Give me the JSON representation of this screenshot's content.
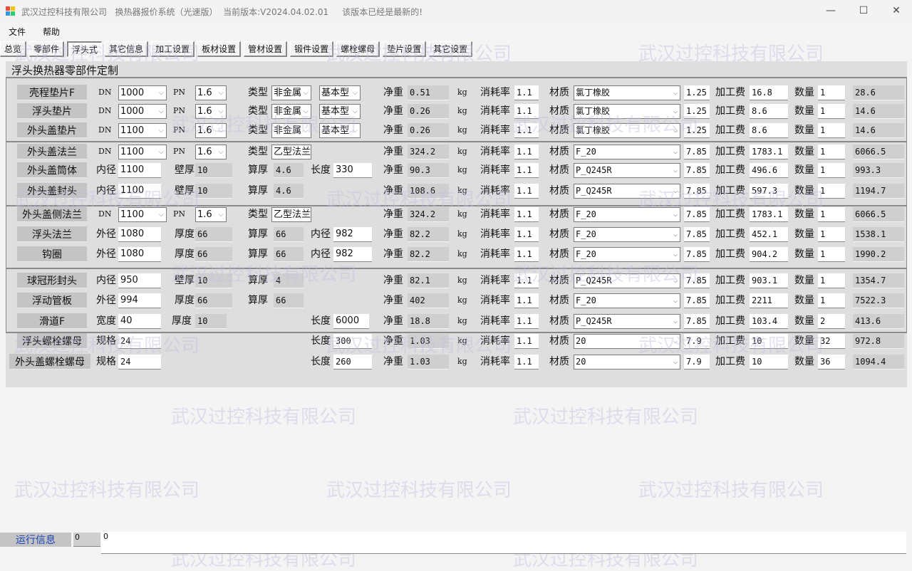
{
  "window": {
    "title": "武汉过控科技有限公司   换热器报价系统（光速版）  当前版本:V2024.04.02.01     该版本已经是最新的!",
    "minimize": "—",
    "maximize": "☐",
    "close": "✕"
  },
  "menu": [
    "文件",
    "帮助"
  ],
  "tabs": [
    {
      "label": "总览",
      "active": false
    },
    {
      "label": "零部件",
      "active": false
    },
    {
      "label": "浮头式",
      "active": true
    },
    {
      "label": "其它信息",
      "active": false
    },
    {
      "label": "加工设置",
      "active": false
    },
    {
      "label": "板材设置",
      "active": false
    },
    {
      "label": "管材设置",
      "active": false
    },
    {
      "label": "锻件设置",
      "active": false
    },
    {
      "label": "螺栓螺母",
      "active": false
    },
    {
      "label": "垫片设置",
      "active": false
    },
    {
      "label": "其它设置",
      "active": false
    }
  ],
  "panel": {
    "title": "浮头换热器零部件定制",
    "labels": {
      "net_weight": "净重",
      "unit": "kg",
      "loss_rate": "消耗率",
      "material": "材质",
      "processing_fee": "加工费",
      "quantity": "数量"
    },
    "rows": [
      {
        "name": "壳程垫片F",
        "fields": [
          {
            "label": "DN",
            "value": "1000",
            "kind": "select"
          },
          {
            "label": "PN",
            "value": "1.6",
            "kind": "select"
          },
          {
            "label": "类型",
            "value": "非金属",
            "kind": "select"
          },
          {
            "label": "",
            "value": "基本型",
            "kind": "select"
          }
        ],
        "net_weight": "0.51",
        "loss_rate": "1.1",
        "material": "氯丁橡胶",
        "density": "1.25",
        "processing_fee": "16.8",
        "quantity": "1",
        "total": "28.6"
      },
      {
        "name": "浮头垫片",
        "fields": [
          {
            "label": "DN",
            "value": "1000",
            "kind": "select"
          },
          {
            "label": "PN",
            "value": "1.6",
            "kind": "select"
          },
          {
            "label": "类型",
            "value": "非金属",
            "kind": "select"
          },
          {
            "label": "",
            "value": "基本型",
            "kind": "select"
          }
        ],
        "net_weight": "0.26",
        "loss_rate": "1.1",
        "material": "氯丁橡胶",
        "density": "1.25",
        "processing_fee": "8.6",
        "quantity": "1",
        "total": "14.6"
      },
      {
        "name": "外头盖垫片",
        "fields": [
          {
            "label": "DN",
            "value": "1100",
            "kind": "select"
          },
          {
            "label": "PN",
            "value": "1.6",
            "kind": "select"
          },
          {
            "label": "类型",
            "value": "非金属",
            "kind": "select"
          },
          {
            "label": "",
            "value": "基本型",
            "kind": "select"
          }
        ],
        "net_weight": "0.26",
        "loss_rate": "1.1",
        "material": "氯丁橡胶",
        "density": "1.25",
        "processing_fee": "8.6",
        "quantity": "1",
        "total": "14.6"
      },
      {
        "name": "外头盖法兰",
        "fields": [
          {
            "label": "DN",
            "value": "1100",
            "kind": "select"
          },
          {
            "label": "PN",
            "value": "1.6",
            "kind": "select"
          },
          {
            "label": "类型",
            "value": "乙型法兰",
            "kind": "select"
          }
        ],
        "net_weight": "324.2",
        "loss_rate": "1.1",
        "material": "F_20",
        "density": "7.85",
        "processing_fee": "1783.1",
        "quantity": "1",
        "total": "6066.5"
      },
      {
        "name": "外头盖筒体",
        "fields": [
          {
            "label": "内径",
            "value": "1100",
            "kind": "input"
          },
          {
            "label": "壁厚",
            "value": "10",
            "kind": "readonly"
          },
          {
            "label": "算厚",
            "value": "4.6",
            "kind": "readonly"
          },
          {
            "label": "长度",
            "value": "330",
            "kind": "input"
          }
        ],
        "net_weight": "90.3",
        "loss_rate": "1.1",
        "material": "P_Q245R",
        "density": "7.85",
        "processing_fee": "496.6",
        "quantity": "1",
        "total": "993.3"
      },
      {
        "name": "外头盖封头",
        "fields": [
          {
            "label": "内径",
            "value": "1100",
            "kind": "input"
          },
          {
            "label": "壁厚",
            "value": "10",
            "kind": "readonly"
          },
          {
            "label": "算厚",
            "value": "4.6",
            "kind": "readonly"
          }
        ],
        "net_weight": "108.6",
        "loss_rate": "1.1",
        "material": "P_Q245R",
        "density": "7.85",
        "processing_fee": "597.3",
        "quantity": "1",
        "total": "1194.7"
      },
      {
        "name": "外头盖侧法兰",
        "fields": [
          {
            "label": "DN",
            "value": "1100",
            "kind": "select"
          },
          {
            "label": "PN",
            "value": "1.6",
            "kind": "select"
          },
          {
            "label": "类型",
            "value": "乙型法兰",
            "kind": "select"
          }
        ],
        "net_weight": "324.2",
        "loss_rate": "1.1",
        "material": "F_20",
        "density": "7.85",
        "processing_fee": "1783.1",
        "quantity": "1",
        "total": "6066.5"
      },
      {
        "name": "浮头法兰",
        "fields": [
          {
            "label": "外径",
            "value": "1080",
            "kind": "input"
          },
          {
            "label": "厚度",
            "value": "66",
            "kind": "readonly"
          },
          {
            "label": "算厚",
            "value": "66",
            "kind": "readonly"
          },
          {
            "label": "内径",
            "value": "982",
            "kind": "input"
          }
        ],
        "net_weight": "82.2",
        "loss_rate": "1.1",
        "material": "F_20",
        "density": "7.85",
        "processing_fee": "452.1",
        "quantity": "1",
        "total": "1538.1"
      },
      {
        "name": "钩圈",
        "fields": [
          {
            "label": "外径",
            "value": "1080",
            "kind": "input"
          },
          {
            "label": "厚度",
            "value": "66",
            "kind": "readonly"
          },
          {
            "label": "算厚",
            "value": "66",
            "kind": "readonly"
          },
          {
            "label": "内径",
            "value": "982",
            "kind": "input"
          }
        ],
        "net_weight": "82.2",
        "loss_rate": "1.1",
        "material": "F_20",
        "density": "7.85",
        "processing_fee": "904.2",
        "quantity": "1",
        "total": "1990.2"
      },
      {
        "name": "球冠形封头",
        "fields": [
          {
            "label": "内径",
            "value": "950",
            "kind": "input"
          },
          {
            "label": "壁厚",
            "value": "10",
            "kind": "readonly"
          },
          {
            "label": "算厚",
            "value": "4",
            "kind": "readonly"
          }
        ],
        "net_weight": "82.1",
        "loss_rate": "1.1",
        "material": "P_Q245R",
        "density": "7.85",
        "processing_fee": "903.1",
        "quantity": "1",
        "total": "1354.7"
      },
      {
        "name": "浮动管板",
        "fields": [
          {
            "label": "外径",
            "value": "994",
            "kind": "input"
          },
          {
            "label": "厚度",
            "value": "66",
            "kind": "readonly"
          },
          {
            "label": "算厚",
            "value": "66",
            "kind": "readonly"
          }
        ],
        "net_weight": "402",
        "loss_rate": "1.1",
        "material": "F_20",
        "density": "7.85",
        "processing_fee": "2211",
        "quantity": "1",
        "total": "7522.3"
      },
      {
        "name": "滑道F",
        "fields": [
          {
            "label": "宽度",
            "value": "40",
            "kind": "input"
          },
          {
            "label": "厚度",
            "value": "10",
            "kind": "readonly"
          },
          {
            "label": "长度",
            "value": "6000",
            "kind": "input"
          }
        ],
        "net_weight": "18.8",
        "loss_rate": "1.1",
        "material": "P_Q245R",
        "density": "7.85",
        "processing_fee": "103.4",
        "quantity": "2",
        "total": "413.6"
      },
      {
        "name": "浮头螺栓螺母",
        "fields": [
          {
            "label": "规格",
            "value": "24",
            "kind": "input"
          },
          {
            "label": "长度",
            "value": "300",
            "kind": "input"
          }
        ],
        "net_weight": "1.03",
        "loss_rate": "1.1",
        "material": "20",
        "density": "7.9",
        "processing_fee": "10",
        "quantity": "32",
        "total": "972.8"
      },
      {
        "name": "外头盖螺栓螺母",
        "fields": [
          {
            "label": "规格",
            "value": "24",
            "kind": "input"
          },
          {
            "label": "长度",
            "value": "260",
            "kind": "input"
          }
        ],
        "net_weight": "1.03",
        "loss_rate": "1.1",
        "material": "20",
        "density": "7.9",
        "processing_fee": "10",
        "quantity": "36",
        "total": "1094.4"
      }
    ]
  },
  "status": {
    "label": "运行信息",
    "count": "0",
    "log": "0"
  },
  "watermark": "武汉过控科技有限公司"
}
